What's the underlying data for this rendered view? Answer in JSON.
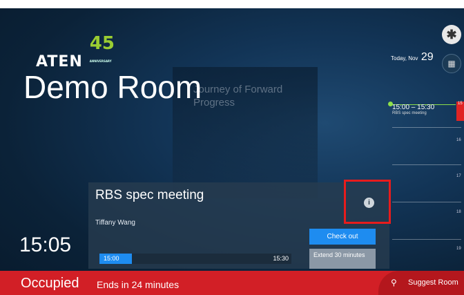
{
  "brand": {
    "name": "ATEN",
    "anniversary": "45",
    "anniversary_sub": "ANNIVERSARY"
  },
  "background": {
    "poster_text": "Journey of Forward Progress"
  },
  "room": {
    "name": "Demo Room",
    "clock": "15:05"
  },
  "header": {
    "date_label": "Today, Nov",
    "date_day": "29",
    "settings_icon": "settings-icon",
    "calendar_icon": "calendar-icon"
  },
  "timeline": {
    "event_time": "15:00 – 15:30",
    "event_name": "RBS spec meeting",
    "hours": [
      "15",
      "16",
      "17",
      "18",
      "19"
    ]
  },
  "meeting": {
    "title": "RBS spec meeting",
    "organizer": "Tiffany Wang",
    "start": "15:00",
    "end": "15:30",
    "progress": 0.17,
    "checkout_label": "Check out",
    "extend_label": "Extend 30 minutes"
  },
  "status": {
    "state": "Occupied",
    "detail": "Ends in 24 minutes",
    "suggest_label": "Suggest Room",
    "color": "#d21f26"
  }
}
